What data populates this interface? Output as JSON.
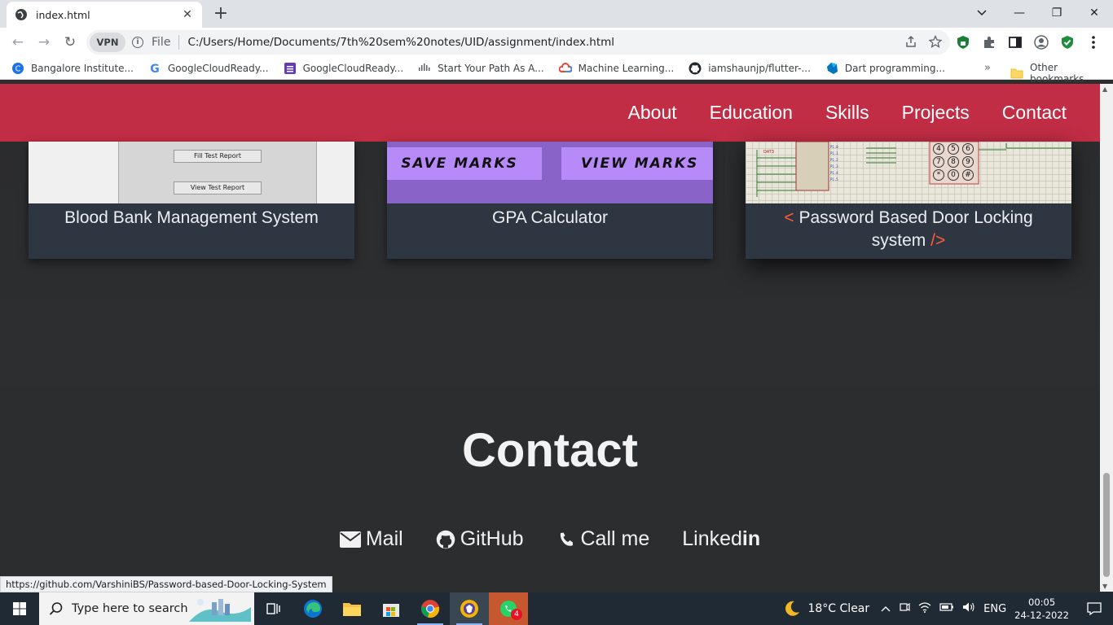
{
  "browser": {
    "tab": {
      "title": "index.html",
      "close": "✕"
    },
    "new_tab": "+",
    "window_controls": {
      "minimize": "—",
      "maximize": "❐",
      "close": "✕"
    },
    "nav": {
      "back": "←",
      "forward": "→",
      "reload": "↻"
    },
    "omnibox": {
      "vpn": "VPN",
      "info": "i",
      "scheme_label": "File",
      "url": "C:/Users/Home/Documents/7th%20sem%20notes/UID/assignment/index.html"
    },
    "bookmarks": [
      {
        "label": "Bangalore Institute...",
        "icon": "bit-icon",
        "color": "#1a73e8"
      },
      {
        "label": "GoogleCloudReady...",
        "icon": "google-icon",
        "color": "#4285f4"
      },
      {
        "label": "GoogleCloudReady...",
        "icon": "forms-icon",
        "color": "#673ab7"
      },
      {
        "label": "Start Your Path As A...",
        "icon": "cisco-icon",
        "color": "#5f6368"
      },
      {
        "label": "Machine Learning...",
        "icon": "cloud-icon",
        "color": "#ea4335"
      },
      {
        "label": "iamshaunjp/flutter-...",
        "icon": "github-icon",
        "color": "#24292e"
      },
      {
        "label": "Dart programming...",
        "icon": "dart-icon",
        "color": "#0175c2"
      }
    ],
    "bookmarks_more": "»",
    "other_bookmarks": "Other bookmarks",
    "status_url": "https://github.com/VarshiniBS/Password-based-Door-Locking-System"
  },
  "site": {
    "nav_links": [
      "About",
      "Education",
      "Skills",
      "Projects",
      "Contact"
    ],
    "projects": [
      {
        "title": "Blood Bank Management System",
        "buttons": [
          "Fill Test Report",
          "View Test Report"
        ]
      },
      {
        "title": "GPA Calculator",
        "buttons": [
          "SAVE MARKS",
          "VIEW MARKS"
        ]
      },
      {
        "title_prefix": "<",
        "title": "Password Based Door Locking system",
        "title_suffix": "/>",
        "keypad": [
          "4",
          "5",
          "6",
          "7",
          "8",
          "9",
          "*",
          "0",
          "#"
        ]
      }
    ],
    "contact": {
      "title": "Contact",
      "links": [
        {
          "label": "Mail",
          "icon": "envelope-icon"
        },
        {
          "label": "GitHub",
          "icon": "github-icon"
        },
        {
          "label": "Call me",
          "icon": "phone-icon"
        },
        {
          "label": "Linked",
          "label_bold": "in",
          "icon": "none"
        }
      ]
    }
  },
  "taskbar": {
    "search_placeholder": "Type here to search",
    "weather": "18°C  Clear",
    "language": "ENG",
    "time": "00:05",
    "date": "24-12-2022",
    "whatsapp_badge": "4"
  },
  "colors": {
    "nav_bg": "#c02d44",
    "card_bg": "#2e3641",
    "accent": "#ff5b3a",
    "page_bg": "#2b2c2e"
  }
}
